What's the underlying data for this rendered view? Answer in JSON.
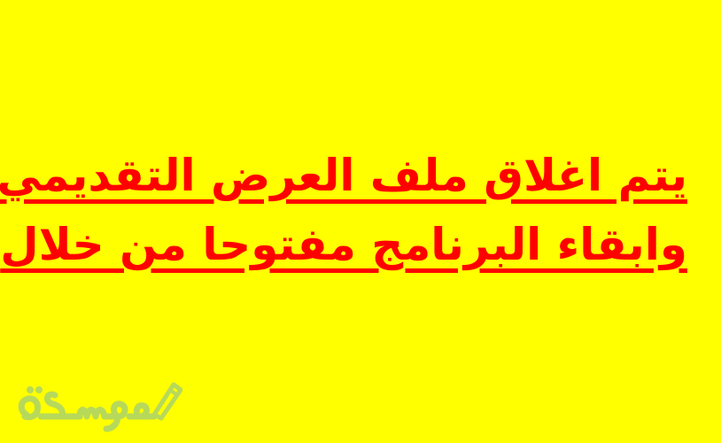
{
  "colors": {
    "background": "#ffff00",
    "text": "#ff0000",
    "logo": "#b7d95a"
  },
  "content": {
    "line1": "يتم اغلاق ملف العرض التقديمي",
    "line2": "وابقاء البرنامج مفتوحا من خلال"
  },
  "logo": {
    "text": "موسوعة",
    "icon": "pen-icon"
  }
}
